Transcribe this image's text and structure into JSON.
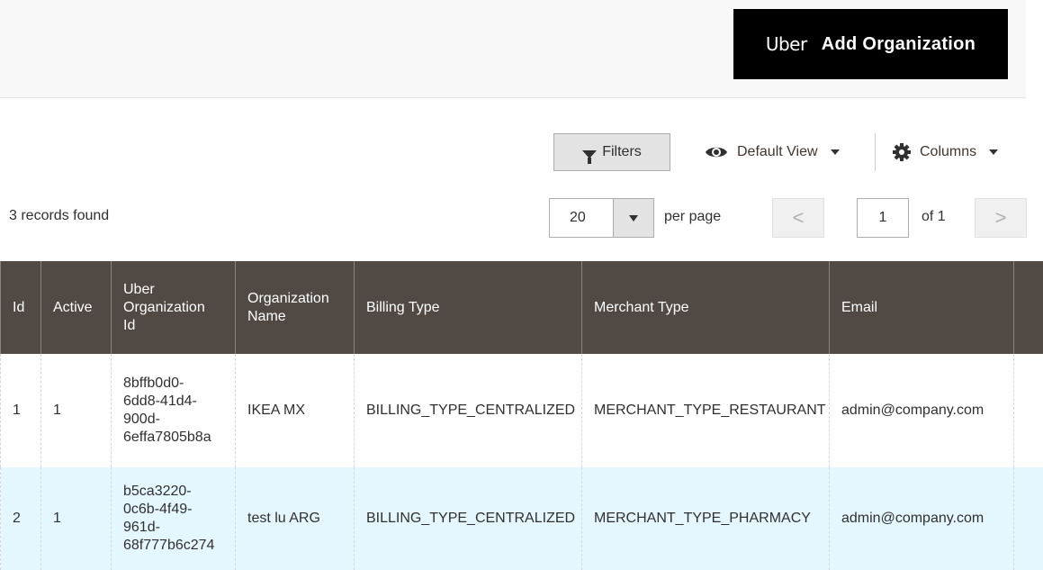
{
  "header": {
    "brand": "Uber",
    "add_button_label": "Add Organization"
  },
  "toolbar": {
    "filters_label": "Filters",
    "view_label": "Default View",
    "columns_label": "Columns"
  },
  "records_found": "3 records found",
  "pagination": {
    "per_page_value": "20",
    "per_page_label": "per page",
    "current_page": "1",
    "of_label": "of 1",
    "prev_symbol": "<",
    "next_symbol": ">"
  },
  "table": {
    "columns": [
      "Id",
      "Active",
      "Uber\nOrganization\nId",
      "Organization\nName",
      "Billing Type",
      "Merchant Type",
      "Email"
    ],
    "rows": [
      {
        "id": "1",
        "active": "1",
        "uber_org_id": "8bffb0d0-\n6dd8-41d4-\n900d-\n6effa7805b8a",
        "org_name": "IKEA MX",
        "billing_type": "BILLING_TYPE_CENTRALIZED",
        "merchant_type": "MERCHANT_TYPE_RESTAURANT",
        "email": "admin@company.com"
      },
      {
        "id": "2",
        "active": "1",
        "uber_org_id": "b5ca3220-\n0c6b-4f49-\n961d-\n68f777b6c274",
        "org_name": "test lu ARG",
        "billing_type": "BILLING_TYPE_CENTRALIZED",
        "merchant_type": "MERCHANT_TYPE_PHARMACY",
        "email": "admin@company.com"
      }
    ]
  },
  "colors": {
    "header_bg": "#514943",
    "button_black": "#000000",
    "alt_row": "#e5f7fe"
  }
}
